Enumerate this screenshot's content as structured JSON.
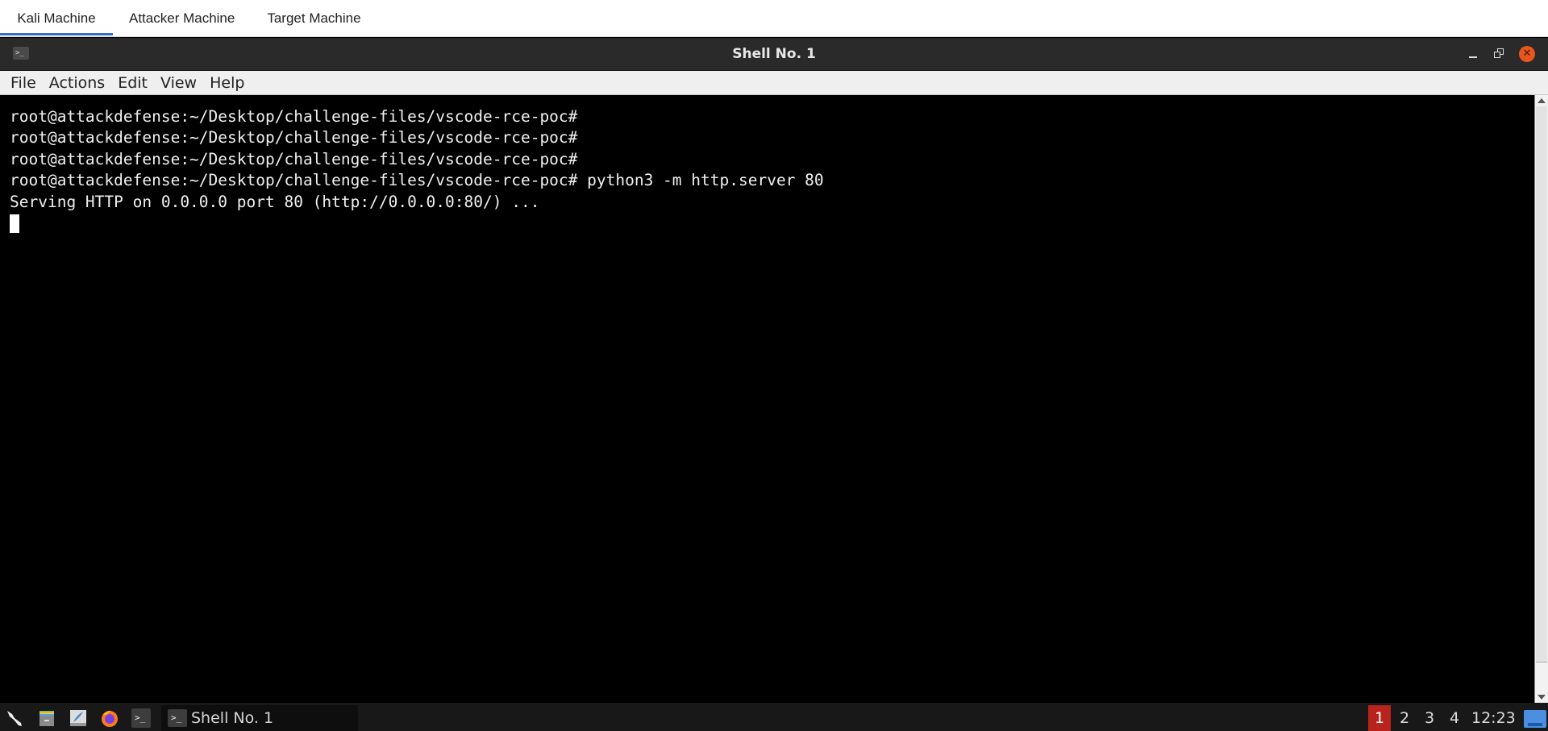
{
  "tabs": [
    {
      "label": "Kali Machine",
      "active": true
    },
    {
      "label": "Attacker Machine",
      "active": false
    },
    {
      "label": "Target Machine",
      "active": false
    }
  ],
  "window": {
    "title": "Shell No. 1",
    "app_icon": "terminal-icon",
    "app_icon_glyph": ">_",
    "controls": {
      "minimize": "minimize-icon",
      "maximize": "restore-icon",
      "close": "close-icon",
      "close_glyph": "✕"
    },
    "close_color": "#e8561c"
  },
  "menu": [
    "File",
    "Actions",
    "Edit",
    "View",
    "Help"
  ],
  "terminal": {
    "lines": [
      "root@attackdefense:~/Desktop/challenge-files/vscode-rce-poc#",
      "root@attackdefense:~/Desktop/challenge-files/vscode-rce-poc#",
      "root@attackdefense:~/Desktop/challenge-files/vscode-rce-poc#",
      "root@attackdefense:~/Desktop/challenge-files/vscode-rce-poc# python3 -m http.server 80",
      "Serving HTTP on 0.0.0.0 port 80 (http://0.0.0.0:80/) ..."
    ],
    "cursor_visible": true
  },
  "scrollbar": {
    "position_fraction": 0.0,
    "visible_fraction": 0.98
  },
  "taskbar": {
    "launchers": [
      {
        "name": "kali-tools-icon"
      },
      {
        "name": "file-manager-icon"
      },
      {
        "name": "text-editor-icon"
      },
      {
        "name": "firefox-icon"
      },
      {
        "name": "terminal-icon",
        "glyph": ">_"
      }
    ],
    "task": {
      "label": "Shell No. 1",
      "glyph": ">_"
    },
    "workspaces": [
      "1",
      "2",
      "3",
      "4"
    ],
    "active_workspace": "1",
    "active_workspace_color": "#b8231d",
    "clock": "12:23"
  }
}
